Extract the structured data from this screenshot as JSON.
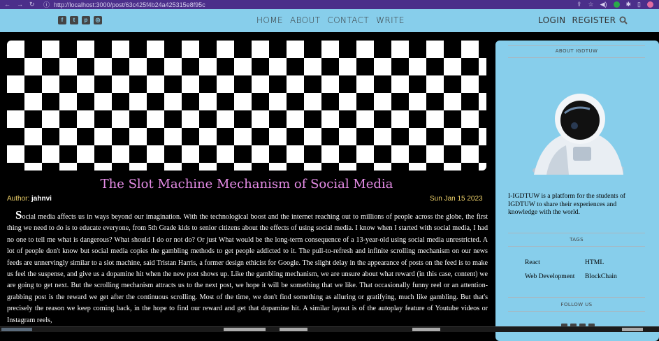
{
  "browser": {
    "url": "http://localhost:3000/post/63c425f4b24a425315e8f95c"
  },
  "header": {
    "social_icons": [
      "facebook-icon",
      "twitter-icon",
      "pinterest-icon",
      "instagram-icon"
    ],
    "menu": [
      "HOME",
      "ABOUT",
      "CONTACT",
      "WRITE"
    ],
    "login": "LOGIN",
    "register": "REGISTER",
    "search_icon": "search-icon"
  },
  "post": {
    "title": "The Slot Machine Mechanism of Social Media",
    "author_label": "Author:",
    "author": "jahnvi",
    "date": "Sun Jan 15 2023",
    "drop_cap": "S",
    "body": "ocial media affects us in ways beyond our imagination. With the technological boost and the internet reaching out to millions of people across the globe, the first thing we need to do is to educate everyone, from 5th Grade kids to senior citizens about the effects of using social media. I know when I started with social media, I had no one to tell me what is dangerous? What should I do or not do? Or just What would be the long-term consequence of a 13-year-old using social media unrestricted. A lot of people don't know but social media copies the gambling methods to get people addicted to it. The pull-to-refresh and infinite scrolling mechanism on our news feeds are unnervingly similar to a slot machine, said Tristan Harris, a former design ethicist for Google. The slight delay in the appearance of posts on the feed is to make us feel the suspense, and give us a dopamine hit when the new post shows up. Like the gambling mechanism, we are unsure about what reward (in this case, content) we are going to get next. But the scrolling mechanism attracts us to the next post, we hope it will be something that we like. That occasionally funny reel or an attention-grabbing post is the reward we get after the continuous scrolling. Most of the time, we don't find something as alluring or gratifying, much like gambling. But that's precisely the reason we keep coming back, in the hope to find our reward and get that dopamine hit. A similar layout is of the autoplay feature of Youtube videos or Instagram reels,"
  },
  "sidebar": {
    "about_title": "ABOUT IGDTUW",
    "about_text": "I-IGDTUW is a platform for the students of IGDTUW to share their experiences and knowledge with the world.",
    "tags_title": "TAGS",
    "tags": [
      "React",
      "HTML",
      "Web Development",
      "BlockChain"
    ],
    "follow_title": "FOLLOW US"
  }
}
